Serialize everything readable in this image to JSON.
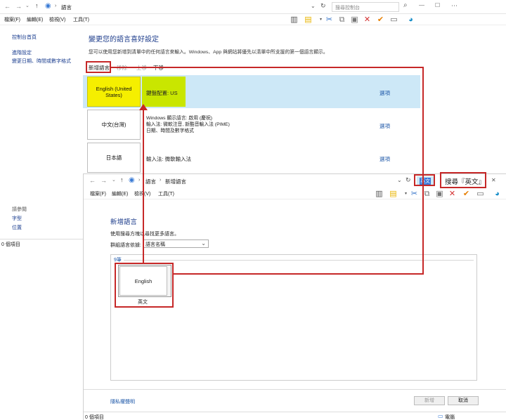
{
  "back_window": {
    "address": {
      "path": "語言",
      "search_placeholder": "搜尋控制台"
    },
    "menu": [
      "檔案(F)",
      "編輯(E)",
      "檢視(V)",
      "工具(T)"
    ],
    "sidebar": {
      "home": "控制台首頁",
      "adv": "進階設定",
      "datetime": "變更日期、時間或數字格式",
      "see_also": "請參閱",
      "font": "字型",
      "location": "位置"
    },
    "status": "0 個項目",
    "title": "變更您的語言喜好設定",
    "desc": "您可以使用您新增到清單中的任何語言來輸入。Windows、App 與網站將優先以清單中所支援的第一個語言顯示。",
    "toolbar": {
      "add": "新增語言",
      "remove": "移除",
      "up": "上移",
      "down": "下移"
    },
    "languages": [
      {
        "name": "English (United States)",
        "detail": "鍵盤配置: US",
        "options": "選項"
      },
      {
        "name": "中文(台灣)",
        "detail": "Windows 顯示語言: 啟用 (慶祝)\n輸入法: 微軟注音, 新酷音輸入法 (PIME)\n日期、時間及數字格式",
        "options": "選項"
      },
      {
        "name": "日本語",
        "detail": "輸入法: 微軟輸入法",
        "options": "選項"
      }
    ]
  },
  "front_window": {
    "address": {
      "path1": "語言",
      "path2": "新增語言",
      "search_value": "英文",
      "search_label": "搜尋『英文』"
    },
    "menu": [
      "檔案(F)",
      "編輯(E)",
      "檢視(V)",
      "工具(T)"
    ],
    "title": "新增語言",
    "hint": "使用搜尋方塊以尋找更多語言。",
    "group_label": "群組語言依據:",
    "group_value": "語言名稱",
    "result_count": "9筆",
    "result": {
      "name": "English",
      "caption": "英文"
    },
    "privacy": "隱私權聲明",
    "add_button": "新增",
    "cancel_button": "取消",
    "status": "0 個項目",
    "status_right": "電腦"
  },
  "colors": {
    "highlight_yellow": "#f5ef00",
    "highlight_green": "#c9e600",
    "selected_row": "#cde8f7",
    "annotation_red": "#c62828",
    "link_blue": "#1d57a8"
  }
}
